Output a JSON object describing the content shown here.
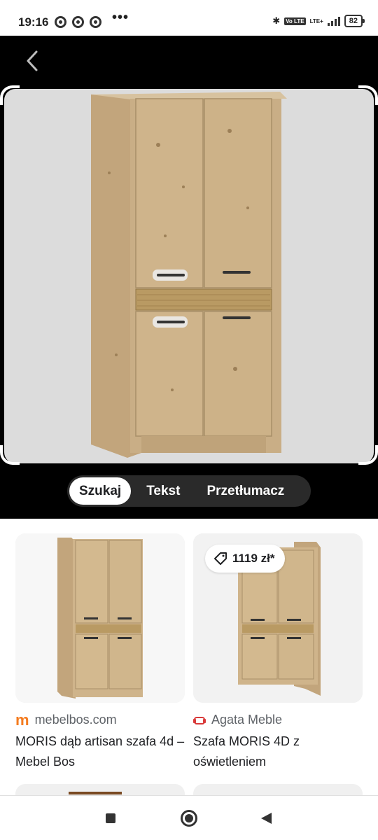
{
  "status_bar": {
    "time": "19:16",
    "dots": "•••",
    "network": "LTE+",
    "volte": "Vo LTE",
    "battery": "82"
  },
  "icons": {
    "back": "arrow-back-icon",
    "chrome": "chrome-icon",
    "price_tag": "tag-icon"
  },
  "mode_tabs": [
    {
      "label": "Szukaj",
      "active": true
    },
    {
      "label": "Tekst",
      "active": false
    },
    {
      "label": "Przetłumacz",
      "active": false
    }
  ],
  "results": [
    {
      "source_logo": "m",
      "source": "mebelbos.com",
      "title": "MORIS dąb artisan szafa 4d – Mebel Bos",
      "price": ""
    },
    {
      "source_logo": "",
      "source": "Agata Meble",
      "title": "Szafa MORIS 4D z oświetleniem",
      "price": "1119 zł*"
    }
  ],
  "colors": {
    "accent_logo_mebelbos": "#f47c20",
    "accent_logo_agata": "#d93a3a",
    "wood": "#c9ae86"
  }
}
